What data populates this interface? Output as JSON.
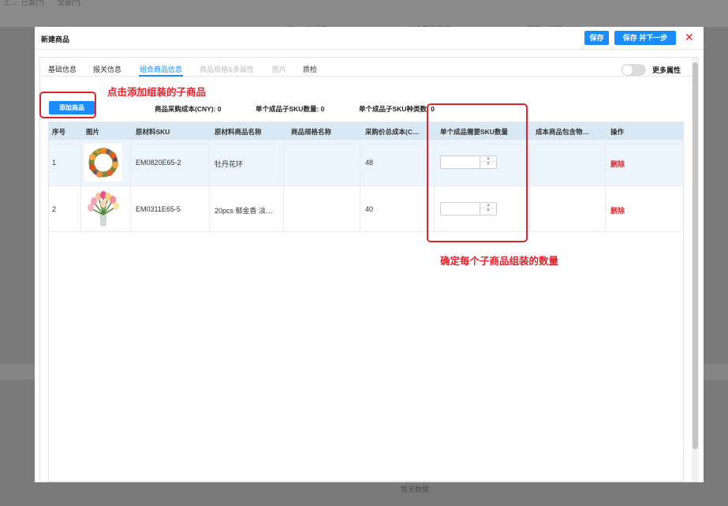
{
  "background": {
    "top_fragments": [
      "上…",
      "已发(?)",
      "全部(?)"
    ],
    "header_fragments": [
      "子 -",
      "种类数",
      "中文商品名称",
      "可用…总量(SKU)"
    ],
    "empty_text": "暂无数据"
  },
  "dialog": {
    "title": "新建商品",
    "save_label": "保存",
    "save_next_label": "保存 并下一步",
    "close_symbol": "✕"
  },
  "tabs": [
    {
      "label": "基础信息",
      "state": "normal"
    },
    {
      "label": "报关信息",
      "state": "normal"
    },
    {
      "label": "组合商品信息",
      "state": "active"
    },
    {
      "label": "商品规格&多属性",
      "state": "disabled"
    },
    {
      "label": "图片",
      "state": "disabled"
    },
    {
      "label": "质检",
      "state": "normal"
    }
  ],
  "more_attrs": {
    "label": "更多属性",
    "enabled": false
  },
  "toolbar": {
    "add_label": "添加商品",
    "cost": "商品采购成本(CNY): 0",
    "sku_qty": "单个成品子SKU数量: 0",
    "sku_kinds": "单个成品子SKU种类数: 0"
  },
  "table": {
    "headers": [
      "序号",
      "图片",
      "原材料SKU",
      "原材料商品名称",
      "商品规格名称",
      "采购价总成本(C…",
      "单个成品需要SKU数量",
      "成本商品包含物…",
      "操作"
    ],
    "rows": [
      {
        "index": "1",
        "image": "peony-wreath-image",
        "sku": "EM0820E65-2",
        "name": "牡丹花环",
        "spec": "",
        "cost": "48",
        "quantity": "",
        "contains": "",
        "action": "删除"
      },
      {
        "index": "2",
        "image": "tulip-bouquet-image",
        "sku": "EM0311E65-5",
        "name": "20pcs 郁金香 淡…",
        "spec": "",
        "cost": "40",
        "quantity": "",
        "contains": "",
        "action": "删除"
      }
    ]
  },
  "annotations": {
    "add_hint": "点击添加组装的子商品",
    "qty_hint": "确定每个子商品组装的数量",
    "color": "#e0232b"
  },
  "colors": {
    "accent": "#1a8cff",
    "danger": "#e0232b",
    "header_bg": "#d9e8f5",
    "row_highlight": "#ecf5fd"
  }
}
